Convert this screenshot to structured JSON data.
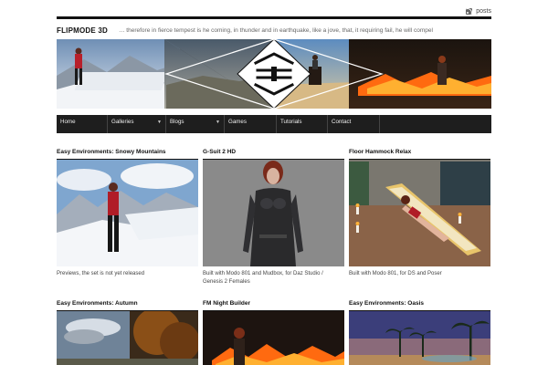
{
  "rss": {
    "label": "posts"
  },
  "site": {
    "title": "FLIPMODE 3D",
    "tagline": "… therefore in fierce tempest is he coming, in thunder and in earthquake, like a jove, that, it requiring fail, he will compel"
  },
  "nav": [
    {
      "label": "Home",
      "dropdown": false
    },
    {
      "label": "Galleries",
      "dropdown": true
    },
    {
      "label": "Blogs",
      "dropdown": true
    },
    {
      "label": "Games",
      "dropdown": false
    },
    {
      "label": "Tutorials",
      "dropdown": false
    },
    {
      "label": "Contact",
      "dropdown": false
    }
  ],
  "cards": [
    {
      "title": "Easy Environments: Snowy Mountains",
      "caption": "Previews, the set is not yet released"
    },
    {
      "title": "G-Suit 2 HD",
      "caption": "Built with Modo 801 and Mudbox, for Daz Studio / Genesis 2 Females"
    },
    {
      "title": "Floor Hammock Relax",
      "caption": "Built with Modo 801, for DS and Poser"
    },
    {
      "title": "Easy Environments: Autumn",
      "caption": ""
    },
    {
      "title": "FM Night Builder",
      "caption": ""
    },
    {
      "title": "Easy Environments: Oasis",
      "caption": ""
    }
  ],
  "colors": {
    "nav_bg": "#1e1e1e",
    "rule": "#111111",
    "text": "#222222"
  }
}
